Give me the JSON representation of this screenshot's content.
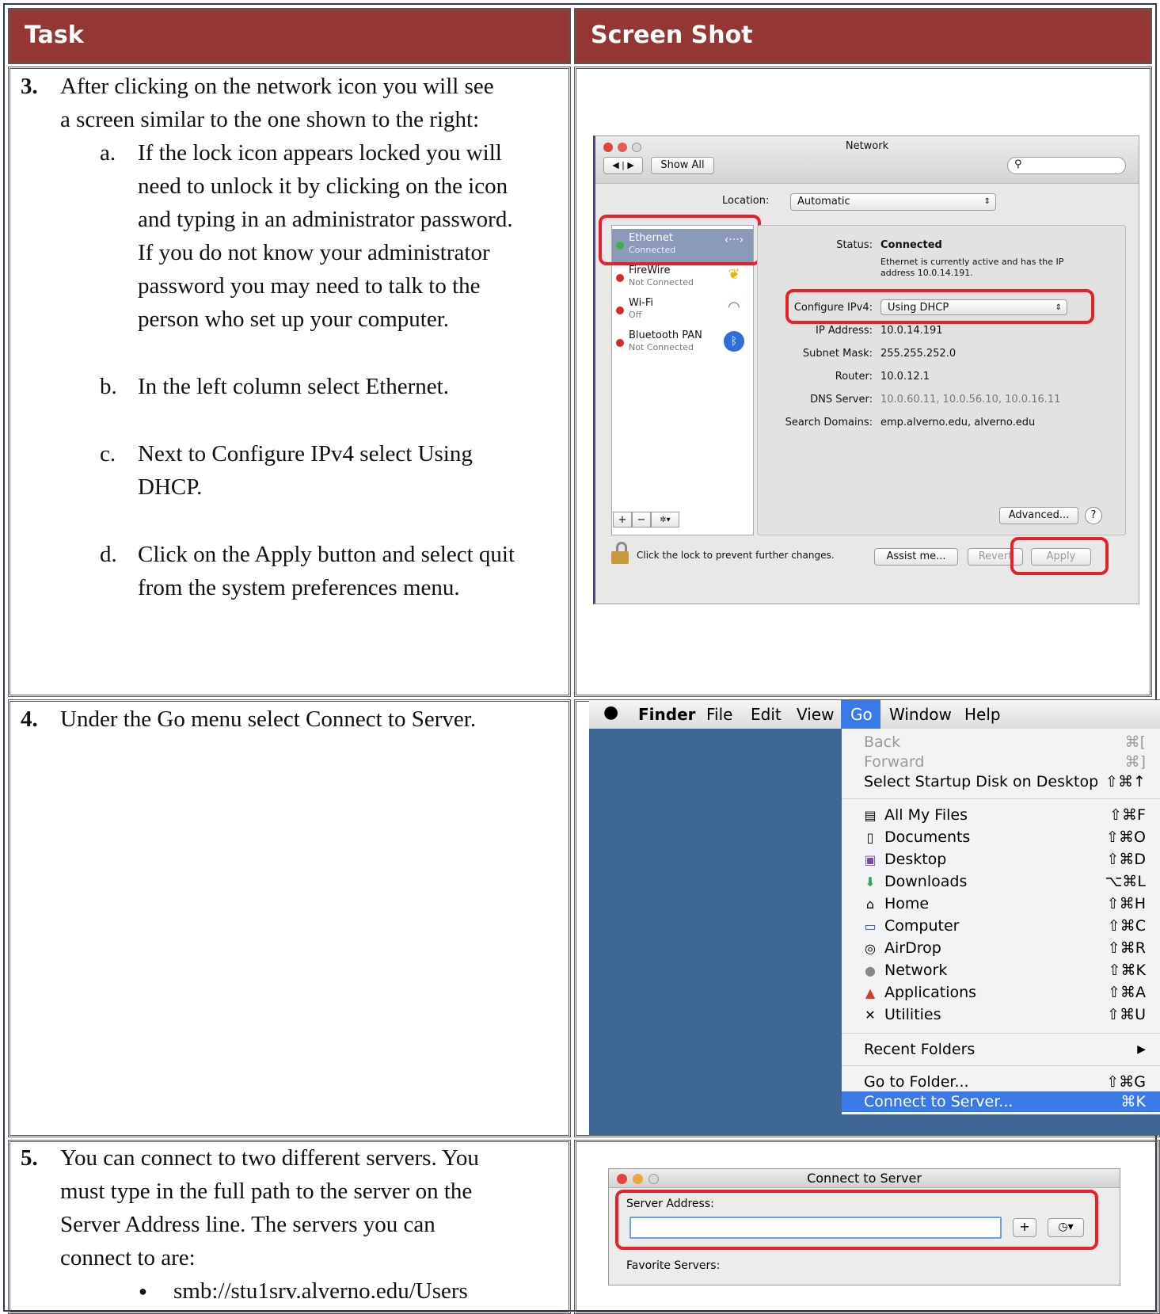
{
  "headers": {
    "task": "Task",
    "screenshot": "Screen Shot"
  },
  "step3": {
    "number": "3.",
    "text_lines": [
      "After clicking on the network icon you will see",
      "a screen similar to the one shown to the right:"
    ],
    "subs": [
      {
        "label": "a.",
        "lines": [
          "If the lock icon appears locked you will",
          "need to unlock it by clicking on the icon",
          "and typing in an administrator password.",
          "If you do not know your administrator",
          "password you may need to talk to the",
          "person who set up your computer."
        ]
      },
      {
        "label": "b.",
        "lines": [
          "In the left column select Ethernet."
        ]
      },
      {
        "label": "c.",
        "lines": [
          "Next to Configure IPv4 select Using",
          "DHCP."
        ]
      },
      {
        "label": "d.",
        "lines": [
          "Click on the Apply button and select quit",
          "from the system preferences menu."
        ]
      }
    ]
  },
  "step4": {
    "number": "4.",
    "text": "Under the Go menu select Connect to Server."
  },
  "step5": {
    "number": "5.",
    "text_lines": [
      "You can connect to two different servers. You",
      "must type in the full path to the server on the",
      "Server Address line. The servers you can",
      "connect to are:"
    ],
    "bullet": "smb://stu1srv.alverno.edu/Users"
  },
  "network_window": {
    "title": "Network",
    "show_all": "Show All",
    "location_label": "Location:",
    "location_value": "Automatic",
    "services": [
      {
        "name": "Ethernet",
        "status": "Connected",
        "dot": "#3cb34a"
      },
      {
        "name": "FireWire",
        "status": "Not Connected",
        "dot": "#d8282a"
      },
      {
        "name": "Wi-Fi",
        "status": "Off",
        "dot": "#d8282a"
      },
      {
        "name": "Bluetooth PAN",
        "status": "Not Connected",
        "dot": "#d8282a"
      }
    ],
    "status_label": "Status:",
    "status_value": "Connected",
    "status_desc": [
      "Ethernet is currently active and has the IP",
      "address 10.0.14.191."
    ],
    "configure_label": "Configure IPv4:",
    "configure_value": "Using DHCP",
    "ip_label": "IP Address:",
    "ip_value": "10.0.14.191",
    "subnet_label": "Subnet Mask:",
    "subnet_value": "255.255.252.0",
    "router_label": "Router:",
    "router_value": "10.0.12.1",
    "dns_label": "DNS Server:",
    "dns_value": "10.0.60.11, 10.0.56.10, 10.0.16.11",
    "search_label": "Search Domains:",
    "search_value": "emp.alverno.edu, alverno.edu",
    "advanced": "Advanced...",
    "help": "?",
    "add": "+",
    "remove": "−",
    "gear": "✲▾",
    "lock_text": "Click the lock to prevent further changes.",
    "assist": "Assist me...",
    "revert": "Revert",
    "apply": "Apply",
    "accent": "#e8202a"
  },
  "finder_menu": {
    "bar": [
      "Finder",
      "File",
      "Edit",
      "View",
      "Go",
      "Window",
      "Help"
    ],
    "items_top": [
      {
        "label": "Back",
        "shortcut": "⌘[",
        "disabled": true
      },
      {
        "label": "Forward",
        "shortcut": "⌘]",
        "disabled": true
      },
      {
        "label": "Select Startup Disk on Desktop",
        "shortcut": "⇧⌘↑",
        "disabled": false
      }
    ],
    "items_places": [
      {
        "label": "All My Files",
        "shortcut": "⇧⌘F",
        "icon": "all-files-icon",
        "glyph": "▤"
      },
      {
        "label": "Documents",
        "shortcut": "⇧⌘O",
        "icon": "document-icon",
        "glyph": "▯"
      },
      {
        "label": "Desktop",
        "shortcut": "⇧⌘D",
        "icon": "desktop-icon",
        "glyph": "▣"
      },
      {
        "label": "Downloads",
        "shortcut": "⌥⌘L",
        "icon": "downloads-icon",
        "glyph": "⬇"
      },
      {
        "label": "Home",
        "shortcut": "⇧⌘H",
        "icon": "home-icon",
        "glyph": "⌂"
      },
      {
        "label": "Computer",
        "shortcut": "⇧⌘C",
        "icon": "computer-icon",
        "glyph": "▭"
      },
      {
        "label": "AirDrop",
        "shortcut": "⇧⌘R",
        "icon": "airdrop-icon",
        "glyph": "◎"
      },
      {
        "label": "Network",
        "shortcut": "⇧⌘K",
        "icon": "network-icon",
        "glyph": "●"
      },
      {
        "label": "Applications",
        "shortcut": "⇧⌘A",
        "icon": "applications-icon",
        "glyph": "▲"
      },
      {
        "label": "Utilities",
        "shortcut": "⇧⌘U",
        "icon": "utilities-icon",
        "glyph": "✕"
      }
    ],
    "recent": "Recent Folders",
    "goto": {
      "label": "Go to Folder...",
      "shortcut": "⇧⌘G"
    },
    "connect": {
      "label": "Connect to Server...",
      "shortcut": "⌘K"
    }
  },
  "connect_window": {
    "title": "Connect to Server",
    "server_address_label": "Server Address:",
    "server_address_value": "",
    "favorites_label": "Favorite Servers:",
    "add": "+",
    "history": "◷▾"
  }
}
